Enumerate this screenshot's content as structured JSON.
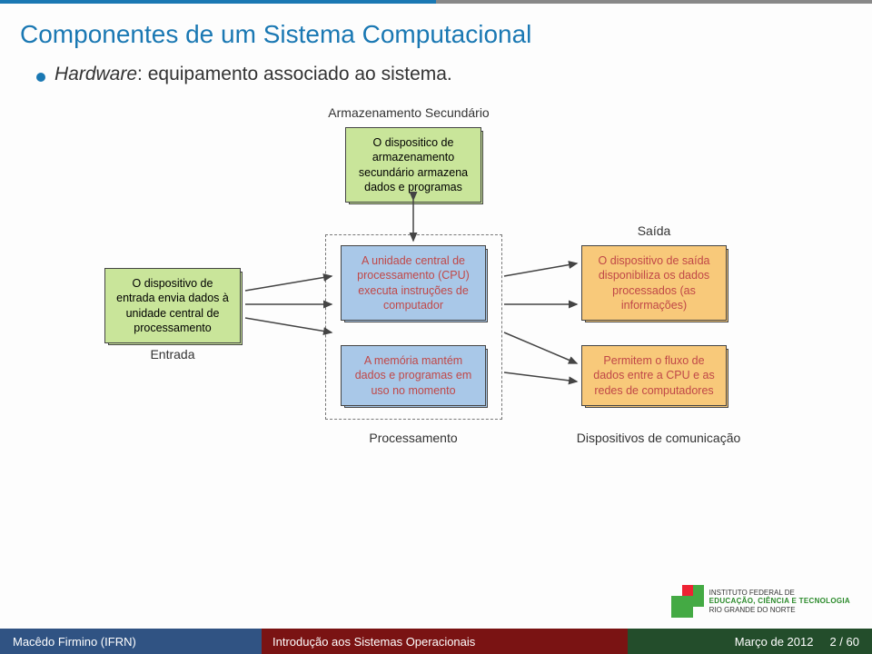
{
  "title": "Componentes de um Sistema Computacional",
  "bullet": {
    "em": "Hardware",
    "rest": ": equipamento associado ao sistema."
  },
  "diagram": {
    "storage_title": "Armazenamento Secundário",
    "storage_box": "O dispositico de armazenamento secundário armazena dados e programas",
    "input_box": "O dispositivo de entrada envia dados à unidade central de processamento",
    "input_label": "Entrada",
    "cpu_box": "A unidade central de processamento (CPU) executa instruções de computador",
    "mem_box": "A memória mantém dados e programas em uso no momento",
    "proc_label": "Processamento",
    "output_title": "Saída",
    "output_box": "O dispositivo de saída disponibiliza os dados processados (as informações)",
    "comm_box": "Permitem o fluxo de dados entre a CPU e as redes de computadores",
    "comm_label": "Dispositivos de comunicação"
  },
  "logo": {
    "l1": "INSTITUTO FEDERAL DE",
    "l2": "EDUCAÇÃO, CIÊNCIA E TECNOLOGIA",
    "l3": "RIO GRANDE DO NORTE"
  },
  "footer": {
    "author": "Macêdo Firmino (IFRN)",
    "subject": "Introdução aos Sistemas Operacionais",
    "date": "Março de 2012",
    "page": "2 / 60"
  }
}
